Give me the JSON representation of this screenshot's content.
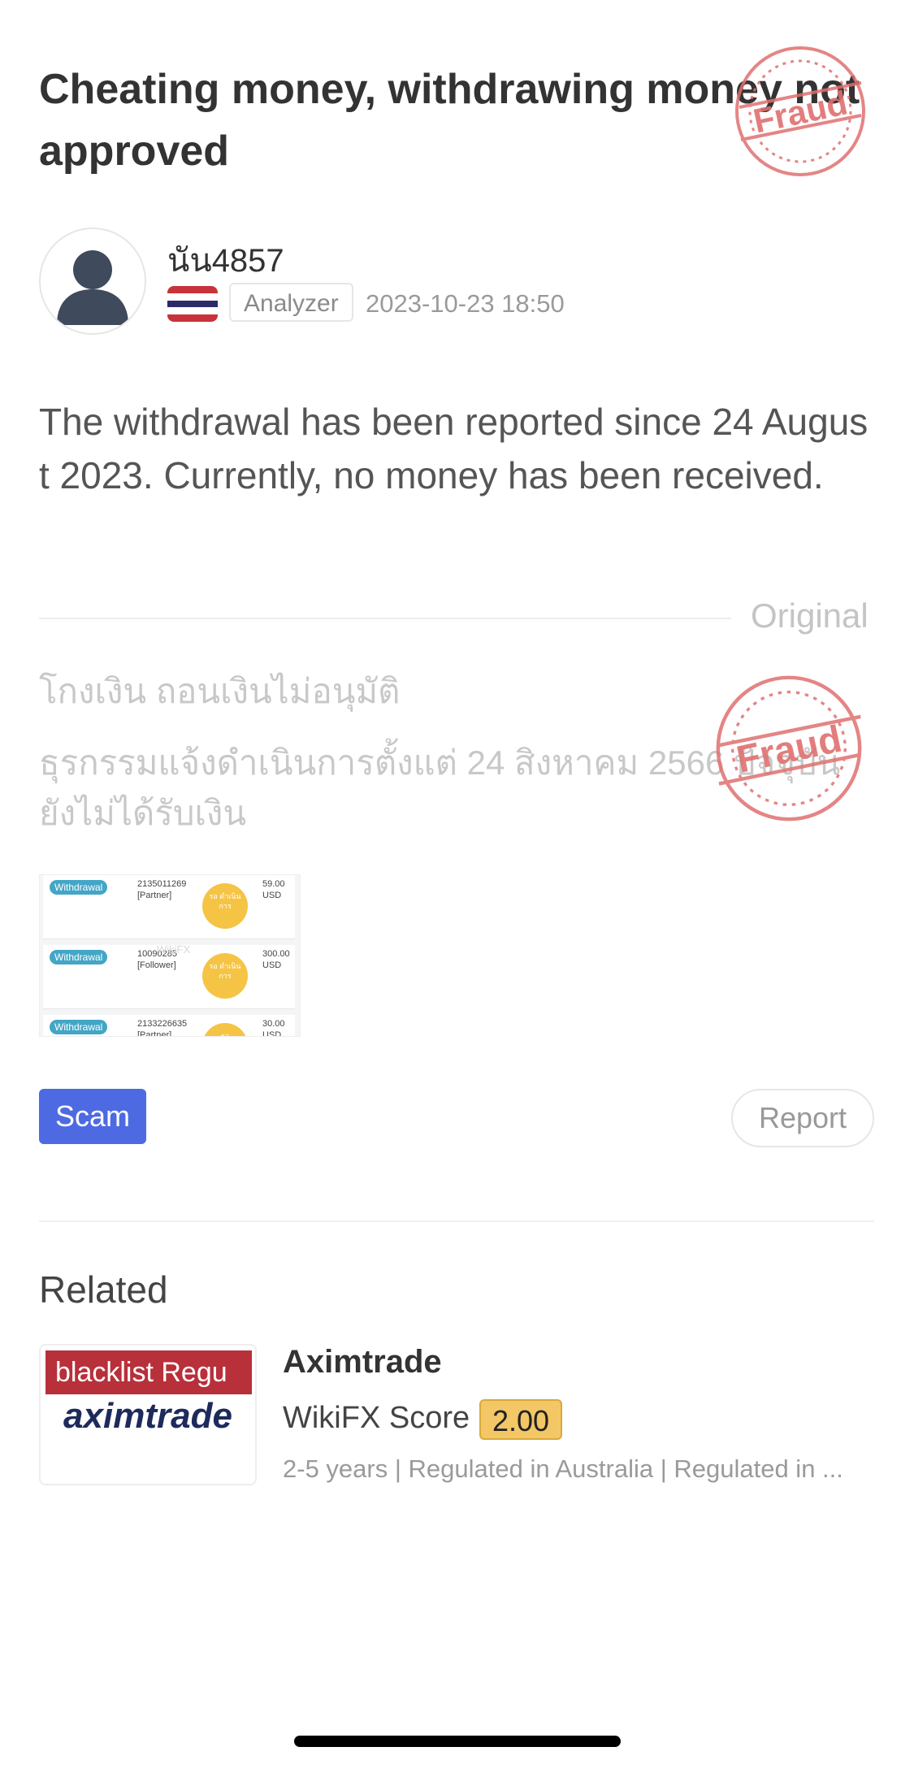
{
  "post": {
    "title": "Cheating money, withdrawing money not approved",
    "stamp_text": "Fraud",
    "author": {
      "username": "นัน4857",
      "country_flag": "thailand-flag-icon",
      "role": "Analyzer",
      "datetime": "2023-10-23 18:50"
    },
    "body": "The withdrawal has been reported since 24 August 2023. Currently, no money has been received.",
    "original": {
      "label": "Original",
      "title": "โกงเงิน  ถอนเงินไม่อนุมัติ",
      "body": "ธุรกรรมแจ้งดำเนินการตั้งแต่ 24 สิงหาคม 2566 ปัจจุบันยังไม่ได้รับเงิน"
    },
    "attachment": {
      "rows": [
        {
          "tag": "Withdrawal",
          "id": "2135011269",
          "role": "[Partner]",
          "status": "รอ ดำเนิน การ",
          "amount": "59.00",
          "currency": "USD"
        },
        {
          "tag": "Withdrawal",
          "id": "10090285",
          "role": "[Follower]",
          "status": "รอ ดำเนิน การ",
          "amount": "300.00",
          "currency": "USD"
        },
        {
          "tag": "Withdrawal",
          "id": "2133226635",
          "role": "[Partner]",
          "status": "รอ",
          "amount": "30.00",
          "currency": "USD"
        }
      ],
      "watermark": "WikiFX"
    },
    "category_label": "Scam",
    "report_label": "Report"
  },
  "related": {
    "heading": "Related",
    "items": [
      {
        "logo_banner": "blacklist   Regu",
        "logo_word": "aximtrade",
        "name": "Aximtrade",
        "score_label": "WikiFX Score",
        "score": "2.00",
        "description": "2-5 years | Regulated in Australia | Regulated in ..."
      }
    ]
  },
  "colors": {
    "stamp": "#e07070",
    "scam_button": "#4d6ae3",
    "score_badge": "#f3c766",
    "blacklist_banner": "#b8303a"
  }
}
